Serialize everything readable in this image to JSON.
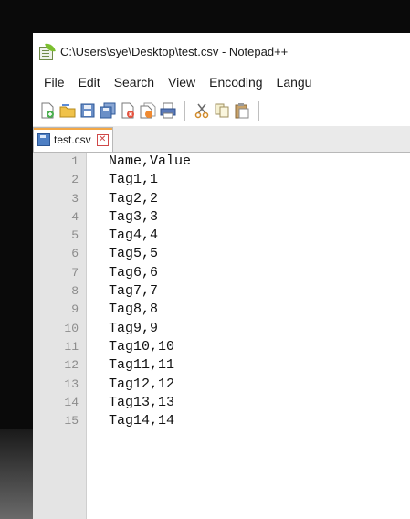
{
  "window": {
    "title": "C:\\Users\\sye\\Desktop\\test.csv - Notepad++"
  },
  "menu": [
    "File",
    "Edit",
    "Search",
    "View",
    "Encoding",
    "Langu"
  ],
  "toolbar": {
    "icons": [
      "new-file-icon",
      "open-file-icon",
      "save-icon",
      "save-all-icon",
      "close-icon",
      "close-all-icon",
      "print-icon",
      "cut-icon",
      "copy-icon",
      "paste-icon"
    ]
  },
  "tabs": [
    {
      "label": "test.csv"
    }
  ],
  "editor": {
    "lines": [
      {
        "num": "1",
        "text": "Name,Value"
      },
      {
        "num": "2",
        "text": "Tag1,1"
      },
      {
        "num": "3",
        "text": "Tag2,2"
      },
      {
        "num": "4",
        "text": "Tag3,3"
      },
      {
        "num": "5",
        "text": "Tag4,4"
      },
      {
        "num": "6",
        "text": "Tag5,5"
      },
      {
        "num": "7",
        "text": "Tag6,6"
      },
      {
        "num": "8",
        "text": "Tag7,7"
      },
      {
        "num": "9",
        "text": "Tag8,8"
      },
      {
        "num": "10",
        "text": "Tag9,9"
      },
      {
        "num": "11",
        "text": "Tag10,10"
      },
      {
        "num": "12",
        "text": "Tag11,11"
      },
      {
        "num": "13",
        "text": "Tag12,12"
      },
      {
        "num": "14",
        "text": "Tag13,13"
      },
      {
        "num": "15",
        "text": "Tag14,14"
      }
    ]
  }
}
